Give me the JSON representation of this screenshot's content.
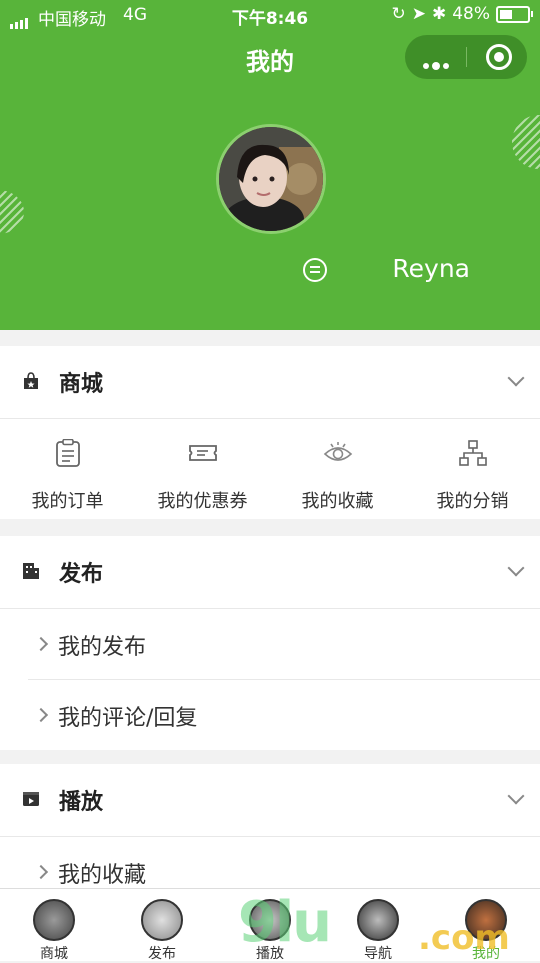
{
  "status_bar": {
    "carrier": "中国移动",
    "network": "4G",
    "time": "下午8:46",
    "battery": "48%",
    "battery_level": 0.48
  },
  "header": {
    "title": "我的",
    "username": "Reyna",
    "color": "#58b43a"
  },
  "shop": {
    "title": "商城",
    "items": [
      {
        "label": "我的订单",
        "icon": "clipboard-icon"
      },
      {
        "label": "我的优惠券",
        "icon": "coupon-icon"
      },
      {
        "label": "我的收藏",
        "icon": "eye-icon"
      },
      {
        "label": "我的分销",
        "icon": "hierarchy-icon"
      }
    ]
  },
  "publish": {
    "title": "发布",
    "rows": [
      "我的发布",
      "我的评论/回复"
    ]
  },
  "play": {
    "title": "播放",
    "rows": [
      "我的收藏"
    ]
  },
  "tabbar": {
    "tabs": [
      {
        "label": "商城"
      },
      {
        "label": "发布"
      },
      {
        "label": "播放"
      },
      {
        "label": "导航"
      },
      {
        "label": "我的"
      }
    ],
    "active_color": "#58b43a"
  },
  "watermark": {
    "text": "9lu",
    "suffix": ".com"
  }
}
